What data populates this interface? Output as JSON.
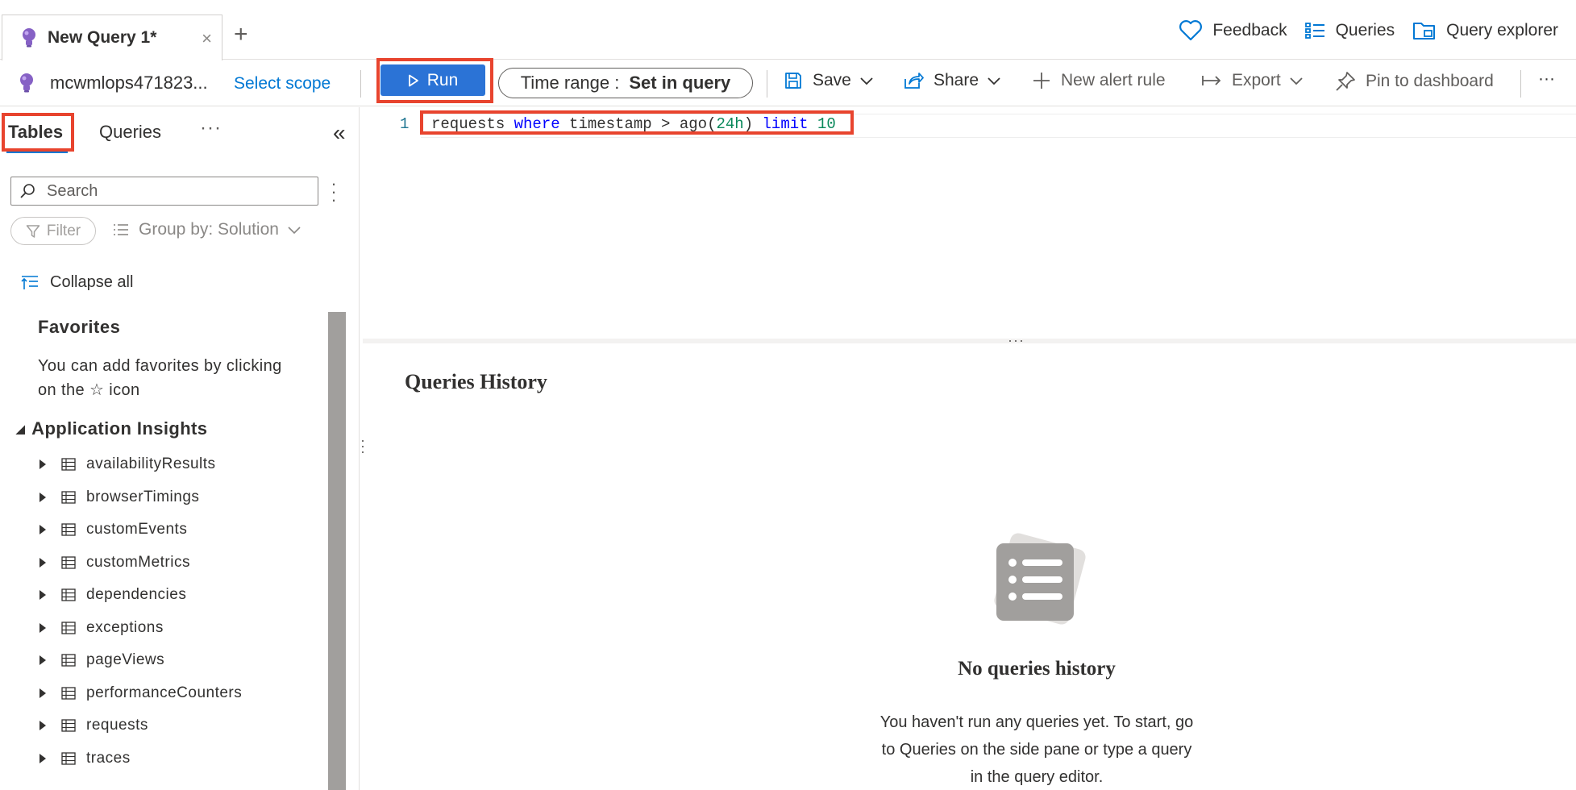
{
  "tabs": {
    "active_title": "New Query 1*",
    "close_symbol": "×",
    "add_symbol": "+"
  },
  "top_links": {
    "feedback": "Feedback",
    "queries": "Queries",
    "query_explorer": "Query explorer"
  },
  "toolbar": {
    "scope_name": "mcwmlops471823...",
    "select_scope": "Select scope",
    "run": "Run",
    "time_range_label": "Time range :",
    "time_range_value": "Set in query",
    "save": "Save",
    "share": "Share",
    "new_alert_rule": "New alert rule",
    "export": "Export",
    "pin_to_dashboard": "Pin to dashboard",
    "more": "···"
  },
  "left_pane": {
    "tab_tables": "Tables",
    "tab_queries": "Queries",
    "more": "···",
    "collapse": "«",
    "search_placeholder": "Search",
    "filter": "Filter",
    "group_by": "Group by: Solution",
    "collapse_all": "Collapse all",
    "favorites_title": "Favorites",
    "favorites_text": "You can add favorites by clicking on the ☆ icon",
    "group_title": "Application Insights",
    "tables": [
      "availabilityResults",
      "browserTimings",
      "customEvents",
      "customMetrics",
      "dependencies",
      "exceptions",
      "pageViews",
      "performanceCounters",
      "requests",
      "traces"
    ]
  },
  "editor": {
    "line_number": "1",
    "tokens": {
      "t1": "requests ",
      "t2": "where",
      "t3": " timestamp > ago(",
      "t4": "24h",
      "t5": ") ",
      "t6": "limit",
      "t7": " ",
      "t8": "10"
    }
  },
  "history": {
    "title": "Queries History",
    "empty_title": "No queries history",
    "empty_text": "You haven't run any queries yet. To start, go to Queries on the side pane or type a query in the query editor."
  },
  "colors": {
    "accent": "#0078d4",
    "run_button": "#2b73d6",
    "highlight_box": "#e8442e",
    "bulb": "#8661c5"
  }
}
